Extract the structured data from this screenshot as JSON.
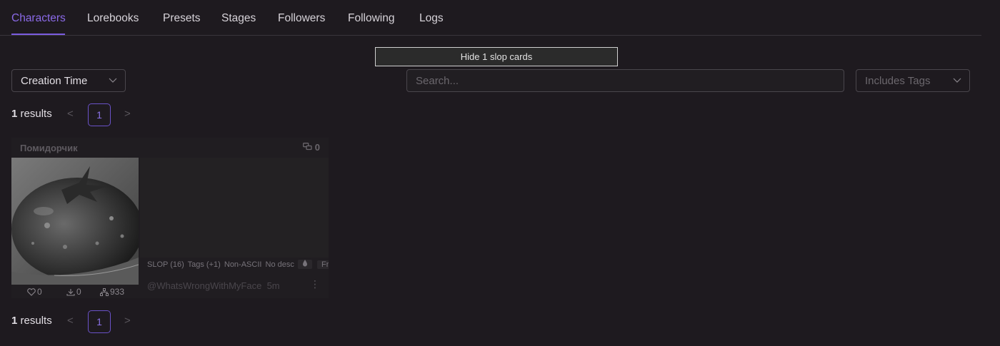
{
  "tabs": [
    {
      "label": "Characters",
      "active": true
    },
    {
      "label": "Lorebooks"
    },
    {
      "label": "Presets"
    },
    {
      "label": "Stages"
    },
    {
      "label": "Followers"
    },
    {
      "label": "Following"
    },
    {
      "label": "Logs"
    }
  ],
  "slop_button": "Hide 1 slop cards",
  "sort": {
    "value": "Creation Time"
  },
  "search": {
    "placeholder": "Search..."
  },
  "tags_filter": {
    "placeholder": "Includes Tags"
  },
  "pagination": {
    "count": "1",
    "results_label": "results",
    "prev": "<",
    "next": ">",
    "page": "1"
  },
  "card": {
    "name": "Помидорчик",
    "chats": "0",
    "tags": [
      "SLOP (16)",
      "Tags (+1)",
      "Non-ASCII",
      "No desc",
      "Fru"
    ],
    "author": "@WhatsWrongWithMyFace",
    "age": "5m",
    "menu": "⋮",
    "likes": "0",
    "downloads": "0",
    "tokens": "933"
  },
  "colors": {
    "accent": "#8b6ae8",
    "background": "#1e1a1f"
  }
}
